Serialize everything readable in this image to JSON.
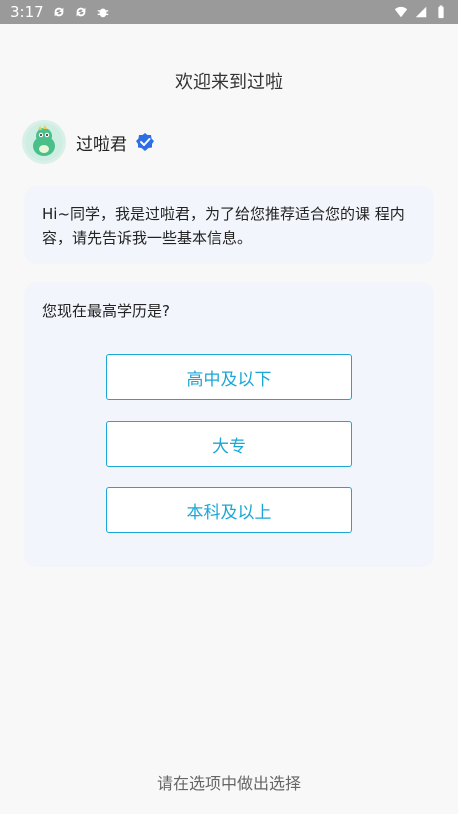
{
  "status_bar": {
    "time": "3:17",
    "icons_left": [
      "sync-icon",
      "sync-icon",
      "bug-icon"
    ],
    "icons_right": [
      "wifi-icon",
      "signal-icon",
      "battery-icon"
    ]
  },
  "header": {
    "title": "欢迎来到过啦"
  },
  "profile": {
    "name": "过啦君",
    "verified_icon": "verified-check-icon"
  },
  "intro": {
    "text": "Hi~同学，我是过啦君，为了给您推荐适合您的课 程内容，请先告诉我一些基本信息。"
  },
  "question": {
    "text": "您现在最高学历是?",
    "options": [
      "高中及以下",
      "大专",
      "本科及以上"
    ]
  },
  "footer": {
    "hint": "请在选项中做出选择"
  },
  "colors": {
    "accent": "#1aa7d6",
    "card_bg": "#f2f5fb",
    "verified": "#2f6fe6"
  }
}
